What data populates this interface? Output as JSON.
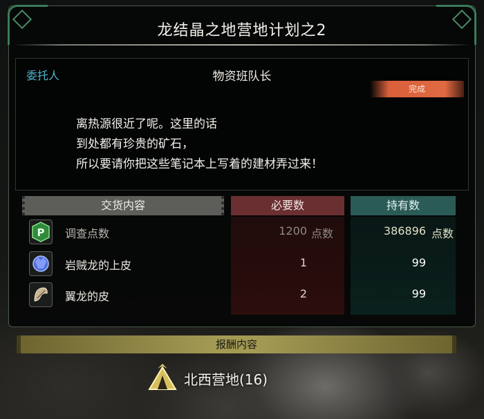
{
  "window": {
    "title": "龙结晶之地营地计划之2"
  },
  "client": {
    "label": "委托人",
    "name": "物资班队长"
  },
  "status": {
    "badge": "完成",
    "color": "#d9603a"
  },
  "dialog": {
    "lines": [
      "离热源很近了呢。这里的话",
      "到处都有珍贵的矿石，",
      "所以要请你把这些笔记本上写着的建材弄过来！"
    ]
  },
  "table": {
    "headers": {
      "item": "交货内容",
      "required": "必要数",
      "owned": "持有数"
    },
    "rows": [
      {
        "icon": "research-points-icon",
        "name": "调查点数",
        "required": "1200",
        "required_unit": "点数",
        "owned": "386896",
        "owned_unit": "点数"
      },
      {
        "icon": "uragaan-scale-icon",
        "name": "岩贼龙的上皮",
        "required": "1",
        "required_unit": "",
        "owned": "99",
        "owned_unit": ""
      },
      {
        "icon": "wyvern-hide-icon",
        "name": "翼龙的皮",
        "required": "2",
        "required_unit": "",
        "owned": "99",
        "owned_unit": ""
      }
    ]
  },
  "reward": {
    "header": "报酬内容",
    "icon": "camp-tent-icon",
    "name": "北西营地(16)"
  },
  "colors": {
    "accent_green": "#3f8a62",
    "required_red": "#6a2f30",
    "owned_teal": "#2a5b57",
    "client_blue": "#4fb3c7"
  }
}
